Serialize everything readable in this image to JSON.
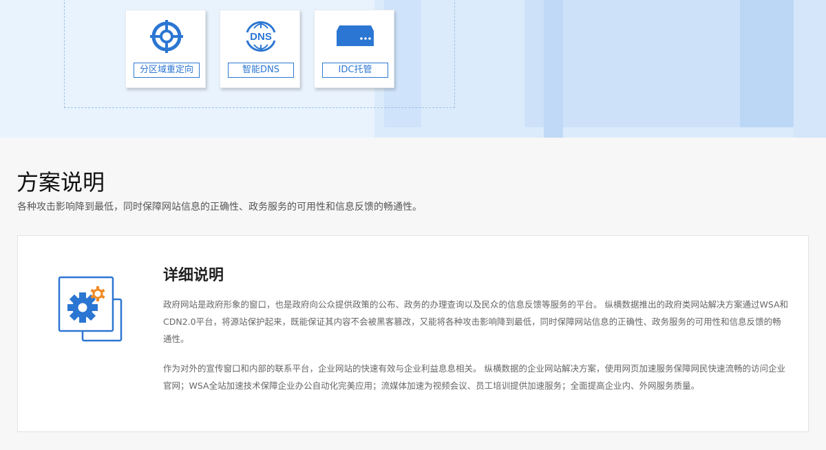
{
  "banner": {
    "services": [
      {
        "label": "分区域重定向",
        "icon": "target-icon"
      },
      {
        "label": "智能DNS",
        "icon": "dns-globe-icon",
        "icon_text": "DNS"
      },
      {
        "label": "IDC托管",
        "icon": "server-icon"
      }
    ]
  },
  "section": {
    "title": "方案说明",
    "subtitle": "各种攻击影响降到最低，同时保障网站信息的正确性、政务服务的可用性和信息反馈的畅通性。"
  },
  "detail": {
    "icon": "gears-icon",
    "title": "详细说明",
    "paragraphs": [
      "政府网站是政府形象的窗口，也是政府向公众提供政策的公布、政务的办理查询以及民众的信息反馈等服务的平台。 纵横数据推出的政府类网站解决方案通过WSA和CDN2.0平台，将源站保护起来，既能保证其内容不会被黑客篡改，又能将各种攻击影响降到最低，同时保障网站信息的正确性、政务服务的可用性和信息反馈的畅通性。",
      "作为对外的宣传窗口和内部的联系平台，企业网站的快速有效与企业利益息息相关。 纵横数据的企业网站解决方案，使用网页加速服务保障网民快速流畅的访问企业官网；WSA全站加速技术保障企业办公自动化完美应用；流媒体加速为视频会议、员工培训提供加速服务；全面提高企业内、外网服务质量。"
    ]
  },
  "colors": {
    "accent": "#2b76d2",
    "accent_orange": "#f08a24",
    "banner_bg": "#e9f3fd",
    "page_bg": "#f7f7f7"
  }
}
